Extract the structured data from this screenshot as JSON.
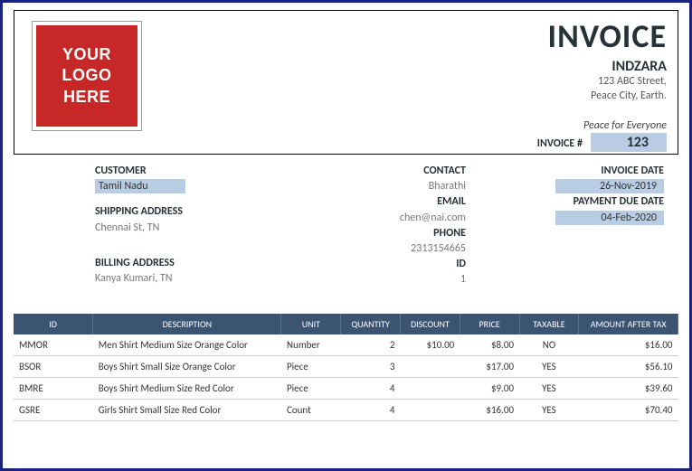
{
  "logo_text": "YOUR LOGO HERE",
  "title": "INVOICE",
  "company": {
    "name": "INDZARA",
    "addr1": "123 ABC Street,",
    "addr2": "Peace City, Earth.",
    "tagline": "Peace for Everyone"
  },
  "invoice_num_label": "INVOICE #",
  "invoice_num": "123",
  "left": {
    "customer_label": "CUSTOMER",
    "customer": "Tamil Nadu",
    "shipping_label": "SHIPPING ADDRESS",
    "shipping": "Chennai St, TN",
    "billing_label": "BILLING ADDRESS",
    "billing": "Kanya Kumari, TN"
  },
  "mid": {
    "contact_label": "CONTACT",
    "contact": "Bharathi",
    "email_label": "EMAIL",
    "email": "chen@nai.com",
    "phone_label": "PHONE",
    "phone": "2313154665",
    "id_label": "ID",
    "id": "1"
  },
  "right": {
    "invoice_date_label": "INVOICE DATE",
    "invoice_date": "26-Nov-2019",
    "due_date_label": "PAYMENT DUE DATE",
    "due_date": "04-Feb-2020"
  },
  "columns": {
    "id": "ID",
    "desc": "DESCRIPTION",
    "unit": "UNIT",
    "qty": "QUANTITY",
    "disc": "DISCOUNT",
    "price": "PRICE",
    "tax": "TAXABLE",
    "amt": "AMOUNT AFTER TAX"
  },
  "rows": [
    {
      "id": "MMOR",
      "desc": "Men Shirt Medium Size Orange Color",
      "unit": "Number",
      "qty": "2",
      "disc": "$10.00",
      "price": "$8.00",
      "tax": "NO",
      "amt": "$16.00"
    },
    {
      "id": "BSOR",
      "desc": "Boys Shirt Small Size Orange Color",
      "unit": "Piece",
      "qty": "3",
      "disc": "",
      "price": "$17.00",
      "tax": "YES",
      "amt": "$56.10"
    },
    {
      "id": "BMRE",
      "desc": "Boys Shirt Medium Size Red Color",
      "unit": "Piece",
      "qty": "4",
      "disc": "",
      "price": "$9.00",
      "tax": "YES",
      "amt": "$39.60"
    },
    {
      "id": "GSRE",
      "desc": "Girls Shirt Small Size Red Color",
      "unit": "Count",
      "qty": "4",
      "disc": "",
      "price": "$16.00",
      "tax": "YES",
      "amt": "$70.40"
    }
  ]
}
